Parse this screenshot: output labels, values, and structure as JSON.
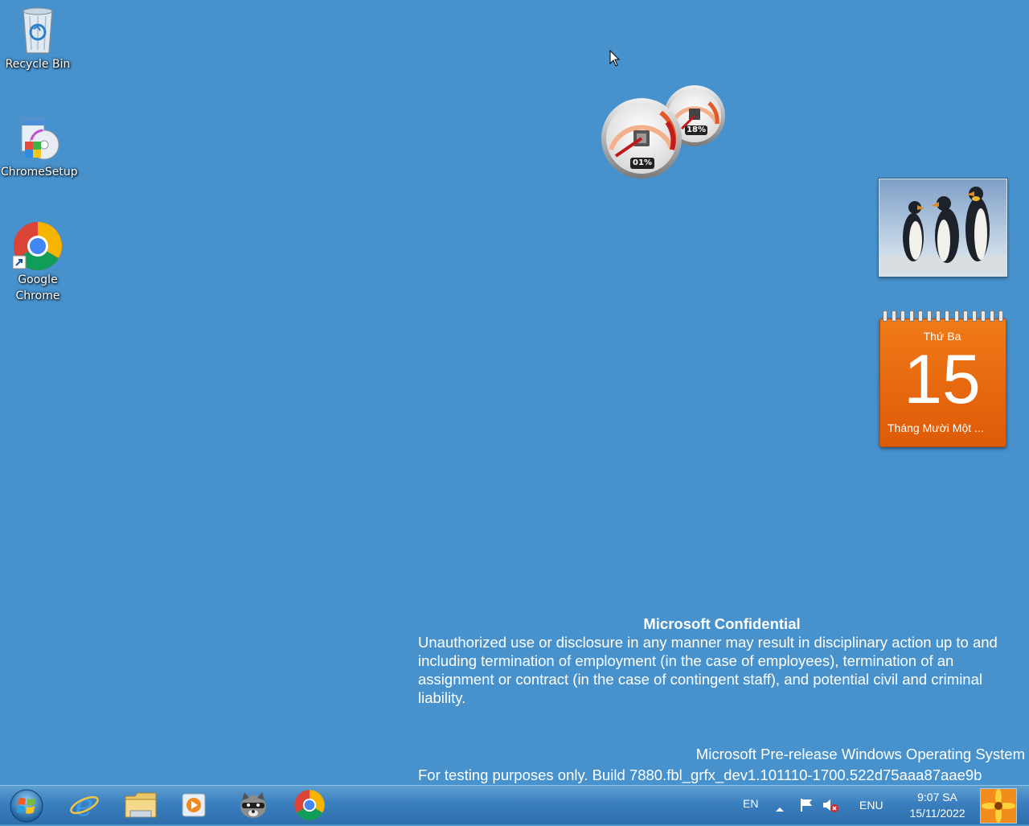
{
  "desktop": {
    "icons": [
      {
        "label": "Recycle Bin",
        "icon": "recycle-bin-icon"
      },
      {
        "label": "ChromeSetup",
        "icon": "installer-icon"
      },
      {
        "label_line1": "Google",
        "label_line2": "Chrome",
        "icon": "chrome-icon"
      }
    ]
  },
  "gadgets": {
    "cpu_meter": {
      "cpu_percent": "01%",
      "memory_percent": "18%"
    },
    "slideshow": {
      "image": "penguins-photo"
    },
    "calendar": {
      "weekday": "Thứ Ba",
      "day": "15",
      "month": "Tháng Mười Một ..."
    }
  },
  "watermark": {
    "title": "Microsoft Confidential",
    "body": "Unauthorized use or disclosure in any manner may result in disciplinary action up to and including termination of employment (in the case of employees), termination of an assignment or contract (in the case of contingent staff), and potential civil and criminal liability.",
    "os": "Microsoft Pre-release Windows Operating System",
    "build": "For testing purposes only. Build 7880.fbl_grfx_dev1.101110-1700.522d75aaa87aae9b"
  },
  "taskbar": {
    "pinned": [
      "internet-explorer-icon",
      "file-explorer-icon",
      "media-player-icon",
      "raccoon-app-icon",
      "chrome-icon"
    ],
    "tray": {
      "language": "EN",
      "input": "ENU",
      "time": "9:07 SA",
      "date": "15/11/2022"
    }
  },
  "colors": {
    "desktop": "#4791cc",
    "calendar": "#e8680f"
  }
}
